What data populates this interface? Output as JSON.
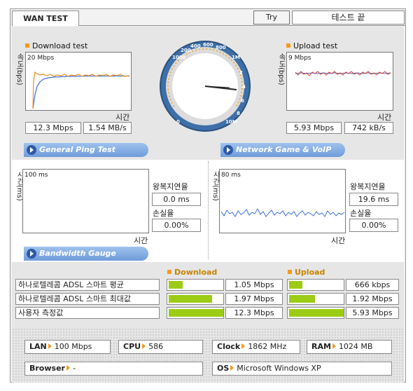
{
  "header": {
    "tab_label": "WAN TEST",
    "try_again_label": "Try again",
    "status_text": "테스트 끝"
  },
  "download_test": {
    "title": "Download test",
    "y_axis_label": "속도(bps)",
    "scale_label": "20 Mbps",
    "x_axis_label": "시간",
    "speed_mbps": "12.3 Mbps",
    "speed_mb": "1.54 MB/s"
  },
  "upload_test": {
    "title": "Upload test",
    "y_axis_label": "속도(bps)",
    "scale_label": "9 Mbps",
    "x_axis_label": "시간",
    "speed_mbps": "5.93 Mbps",
    "speed_kb": "742 kB/s"
  },
  "gauge": {
    "tick_labels": [
      "0",
      "100k",
      "200",
      "400",
      "600",
      "800",
      "1M",
      "2",
      "4",
      "6",
      "8",
      "10M"
    ],
    "needle_value_label": "12.3 Mbps"
  },
  "general_ping": {
    "section_label": "General Ping Test",
    "y_axis_label": "시간(ms)",
    "scale_label": "100 ms",
    "x_axis_label": "시간",
    "rtt_label": "왕복지연율",
    "rtt_value": "0.0 ms",
    "loss_label": "손실율",
    "loss_value": "0.00%"
  },
  "game_voip": {
    "section_label": "Network Game & VoIP Test",
    "y_axis_label": "시간(ms)",
    "scale_label": "80 ms",
    "x_axis_label": "시간",
    "rtt_label": "왕복지연율",
    "rtt_value": "19.6 ms",
    "loss_label": "손실율",
    "loss_value": "0.00%"
  },
  "bandwidth_gauge": {
    "section_label": "Bandwidth Gauge",
    "download_legend": "Download",
    "upload_legend": "Upload",
    "rows": [
      {
        "label": "하나로텔레콤 ADSL 스마트 평균",
        "download": "1.05 Mbps",
        "download_fraction": 0.26,
        "upload": "666 kbps",
        "upload_fraction": 0.24
      },
      {
        "label": "하나로텔레콤 ADSL 스마트 최대값",
        "download": "1.97 Mbps",
        "download_fraction": 0.8,
        "upload": "1.92 Mbps",
        "upload_fraction": 0.47
      },
      {
        "label": "사용자 측정값",
        "download": "12.3 Mbps",
        "download_fraction": 1.0,
        "upload": "5.93 Mbps",
        "upload_fraction": 1.0
      }
    ]
  },
  "system_info": {
    "lan_label": "LAN",
    "lan_value": "100 Mbps",
    "cpu_label": "CPU",
    "cpu_value": "586",
    "clock_label": "Clock",
    "clock_value": "1862 MHz",
    "ram_label": "RAM",
    "ram_value": "1024 MB",
    "browser_label": "Browser",
    "browser_value": "-",
    "os_label": "OS",
    "os_value": "Microsoft Windows XP"
  },
  "colors": {
    "download_line": "#f08a1a",
    "reference_line": "#3c6fd8",
    "bar_fill": "#9ccc15",
    "accent_orange": "#f49a1e",
    "section_blue": "#6f9bd9"
  }
}
